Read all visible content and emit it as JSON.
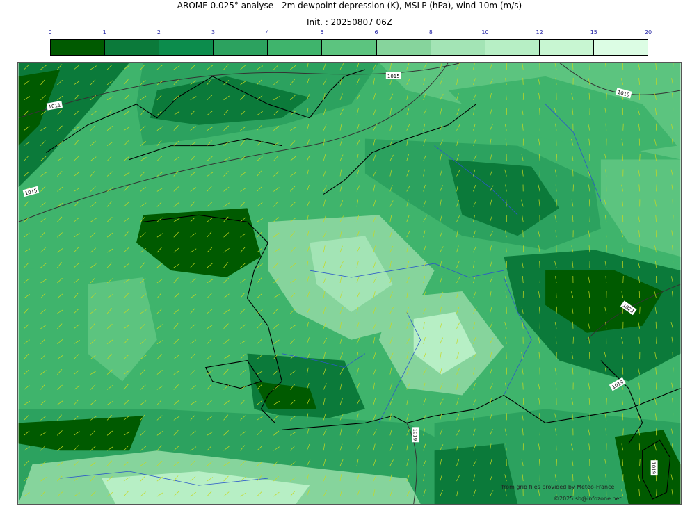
{
  "title": "AROME 0.025° analyse - 2m dewpoint depression (K), MSLP (hPa), wind 10m (m/s)",
  "init": "Init. : 20250807 06Z",
  "legend": {
    "ticks": [
      "0",
      "1",
      "2",
      "3",
      "4",
      "5",
      "6",
      "8",
      "10",
      "12",
      "15",
      "20"
    ],
    "colors": [
      "#005a00",
      "#0b7a3a",
      "#0c8c4c",
      "#2ca25f",
      "#3fb46c",
      "#5cc47f",
      "#86d49c",
      "#a3e4b5",
      "#b7efc5",
      "#c8f6d2",
      "#dcfde4"
    ]
  },
  "isobars": [
    "1015",
    "1011",
    "1015",
    "1019",
    "1015",
    "1023",
    "1019",
    "1019",
    "1019"
  ],
  "credits": {
    "source": "from grib files provided by Meteo-France",
    "copyright": "©2025 sb@infozone.net"
  }
}
